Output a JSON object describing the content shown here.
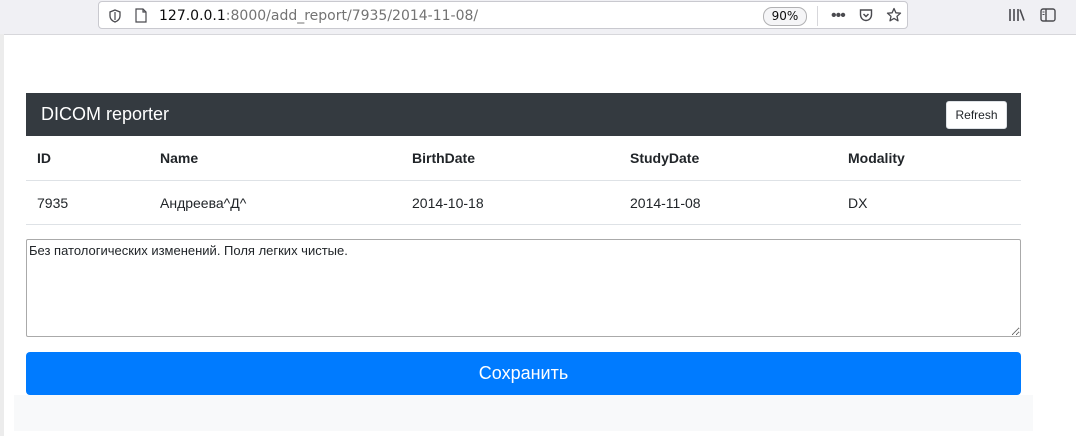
{
  "browser": {
    "url_host": "127.0.0.1",
    "url_rest": ":8000/add_report/7935/2014-11-08/",
    "zoom": "90%",
    "more_label": "•••"
  },
  "navbar": {
    "brand": "DICOM reporter",
    "refresh_label": "Refresh"
  },
  "table": {
    "headers": [
      "ID",
      "Name",
      "BirthDate",
      "StudyDate",
      "Modality"
    ],
    "rows": [
      [
        "7935",
        "Андреева^Д^",
        "2014-10-18",
        "2014-11-08",
        "DX"
      ]
    ]
  },
  "report": {
    "text": "Без патологических изменений. Поля легких чистые."
  },
  "save_label": "Сохранить",
  "colors": {
    "navbar_bg": "#343a40",
    "primary": "#007bff"
  }
}
